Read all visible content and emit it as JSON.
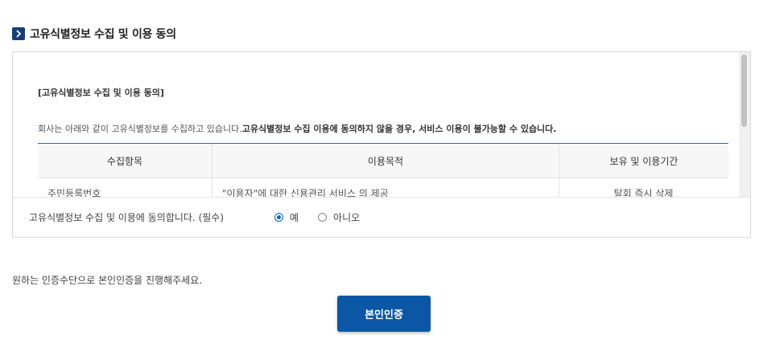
{
  "section": {
    "title": "고유식별정보 수집 및 이용 동의"
  },
  "terms": {
    "heading": "[고유식별정보 수집 및 이용 동의]",
    "desc_normal": "회사는 아래와 같이 고유식별정보를 수집하고 있습니다.",
    "desc_bold": "고유식별정보 수집 이용에 동의하지 않을 경우, 서비스 이용이 불가능할 수 있습니다.",
    "columns": [
      "수집항목",
      "이용목적",
      "보유 및 이용기간"
    ],
    "rows": [
      {
        "item": "주민등록번호",
        "purpose": "\"이용자\"에 대한 신용관리 서비스 의 제공",
        "period": "탈회 즉시 삭제"
      }
    ]
  },
  "consent": {
    "label": "고유식별정보 수집 및 이용에 동의합니다. (필수)",
    "yes": "예",
    "no": "아니오",
    "selected": "yes"
  },
  "guide": "원하는 인증수단으로 본인인증을 진행해주세요.",
  "button": {
    "label": "본인인증"
  },
  "colors": {
    "accent": "#0b57a6",
    "icon_bg": "#163f7a",
    "table_top_border": "#2e6aa3"
  }
}
